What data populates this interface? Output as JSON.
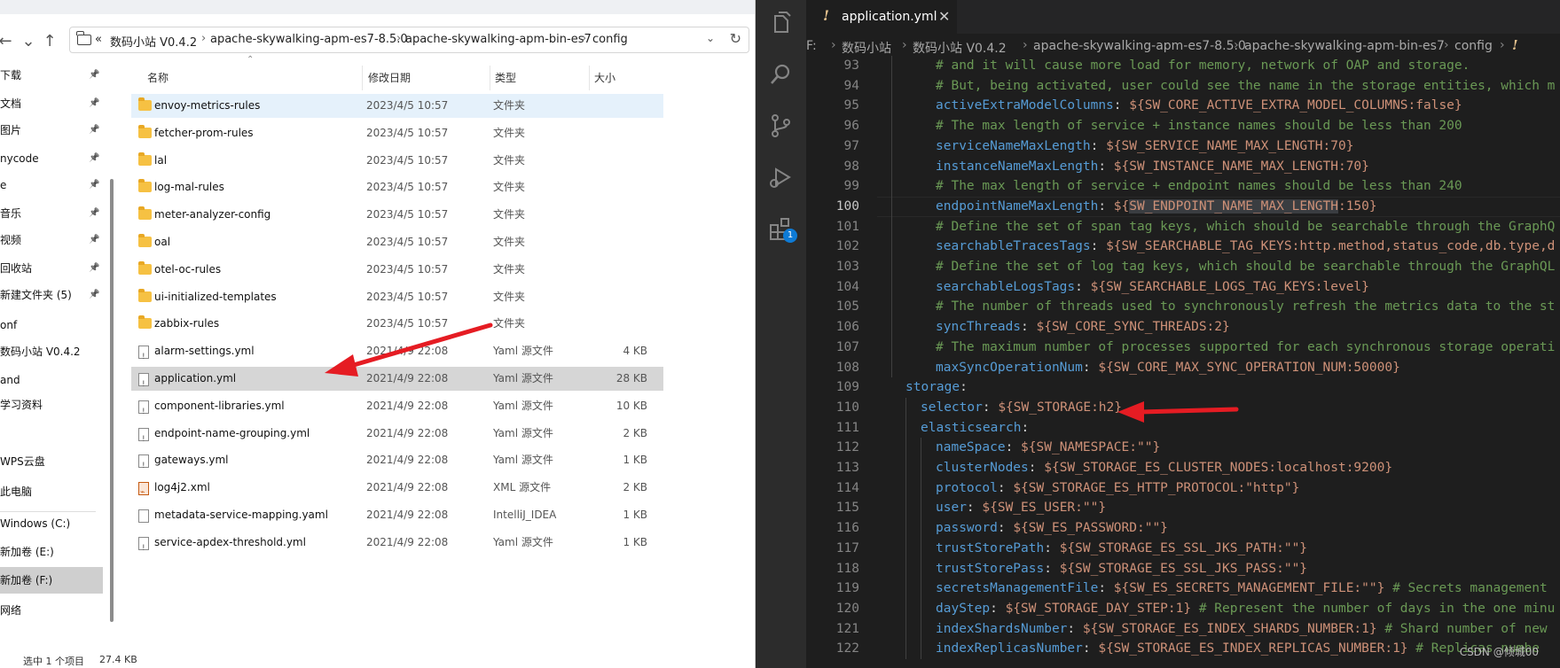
{
  "explorer": {
    "address": {
      "crumbs": [
        "«",
        "数码小站 V0.4.2",
        "apache-skywalking-apm-es7-8.5.0",
        "apache-skywalking-apm-bin-es7",
        "config"
      ]
    },
    "nav_items": [
      {
        "label": "下载",
        "pinned": true
      },
      {
        "label": "文档",
        "pinned": true
      },
      {
        "label": "图片",
        "pinned": true
      },
      {
        "label": "nycode",
        "pinned": true
      },
      {
        "label": "e",
        "pinned": true
      },
      {
        "label": "音乐",
        "pinned": true
      },
      {
        "label": "视频",
        "pinned": true
      },
      {
        "label": "回收站",
        "pinned": true
      },
      {
        "label": "新建文件夹 (5)",
        "pinned": true
      },
      {
        "label": "onf",
        "pinned": false
      },
      {
        "label": "数码小站 V0.4.2",
        "pinned": false
      },
      {
        "label": "and",
        "pinned": false
      },
      {
        "label": "学习资料",
        "pinned": false
      },
      {
        "label": "WPS云盘",
        "pinned": false
      },
      {
        "label": "此电脑",
        "pinned": false
      },
      {
        "label": "Windows (C:)",
        "pinned": false
      },
      {
        "label": "新加卷 (E:)",
        "pinned": false
      },
      {
        "label": "新加卷 (F:)",
        "pinned": false
      },
      {
        "label": "网络",
        "pinned": false
      }
    ],
    "columns": {
      "name": "名称",
      "date": "修改日期",
      "type": "类型",
      "size": "大小"
    },
    "files": [
      {
        "name": "envoy-metrics-rules",
        "date": "2023/4/5 10:57",
        "type": "文件夹",
        "size": "",
        "icon": "folder"
      },
      {
        "name": "fetcher-prom-rules",
        "date": "2023/4/5 10:57",
        "type": "文件夹",
        "size": "",
        "icon": "folder"
      },
      {
        "name": "lal",
        "date": "2023/4/5 10:57",
        "type": "文件夹",
        "size": "",
        "icon": "folder"
      },
      {
        "name": "log-mal-rules",
        "date": "2023/4/5 10:57",
        "type": "文件夹",
        "size": "",
        "icon": "folder"
      },
      {
        "name": "meter-analyzer-config",
        "date": "2023/4/5 10:57",
        "type": "文件夹",
        "size": "",
        "icon": "folder"
      },
      {
        "name": "oal",
        "date": "2023/4/5 10:57",
        "type": "文件夹",
        "size": "",
        "icon": "folder"
      },
      {
        "name": "otel-oc-rules",
        "date": "2023/4/5 10:57",
        "type": "文件夹",
        "size": "",
        "icon": "folder"
      },
      {
        "name": "ui-initialized-templates",
        "date": "2023/4/5 10:57",
        "type": "文件夹",
        "size": "",
        "icon": "folder"
      },
      {
        "name": "zabbix-rules",
        "date": "2023/4/5 10:57",
        "type": "文件夹",
        "size": "",
        "icon": "folder"
      },
      {
        "name": "alarm-settings.yml",
        "date": "2021/4/9 22:08",
        "type": "Yaml 源文件",
        "size": "4 KB",
        "icon": "yaml"
      },
      {
        "name": "application.yml",
        "date": "2021/4/9 22:08",
        "type": "Yaml 源文件",
        "size": "28 KB",
        "icon": "yaml"
      },
      {
        "name": "component-libraries.yml",
        "date": "2021/4/9 22:08",
        "type": "Yaml 源文件",
        "size": "10 KB",
        "icon": "yaml"
      },
      {
        "name": "endpoint-name-grouping.yml",
        "date": "2021/4/9 22:08",
        "type": "Yaml 源文件",
        "size": "2 KB",
        "icon": "yaml"
      },
      {
        "name": "gateways.yml",
        "date": "2021/4/9 22:08",
        "type": "Yaml 源文件",
        "size": "1 KB",
        "icon": "yaml"
      },
      {
        "name": "log4j2.xml",
        "date": "2021/4/9 22:08",
        "type": "XML 源文件",
        "size": "2 KB",
        "icon": "xml"
      },
      {
        "name": "metadata-service-mapping.yaml",
        "date": "2021/4/9 22:08",
        "type": "IntelliJ_IDEA",
        "size": "1 KB",
        "icon": "plain"
      },
      {
        "name": "service-apdex-threshold.yml",
        "date": "2021/4/9 22:08",
        "type": "Yaml 源文件",
        "size": "1 KB",
        "icon": "yaml"
      }
    ],
    "status": {
      "selection": "选中 1 个项目",
      "size": "27.4 KB"
    }
  },
  "vscode": {
    "tab": {
      "name": "application.yml"
    },
    "breadcrumbs": [
      "F:",
      "数码小站",
      "数码小站 V0.4.2",
      "apache-skywalking-apm-es7-8.5.0",
      "apache-skywalking-apm-bin-es7",
      "config"
    ],
    "extensions_badge": "1",
    "active_line": "100",
    "lines": [
      {
        "n": "93",
        "parts": [
          {
            "t": "# and it will cause more load for memory, network of OAP and storage.",
            "c": "c"
          }
        ]
      },
      {
        "n": "94",
        "parts": [
          {
            "t": "# But, being activated, user could see the name in the storage entities, which m",
            "c": "c"
          }
        ]
      },
      {
        "n": "95",
        "parts": [
          {
            "t": "activeExtraModelColumns",
            "c": "k"
          },
          {
            "t": ": ",
            "c": "p"
          },
          {
            "t": "${SW_CORE_ACTIVE_EXTRA_MODEL_COLUMNS:false}",
            "c": "v"
          }
        ]
      },
      {
        "n": "96",
        "parts": [
          {
            "t": "# The max length of service + instance names should be less than 200",
            "c": "c"
          }
        ]
      },
      {
        "n": "97",
        "parts": [
          {
            "t": "serviceNameMaxLength",
            "c": "k"
          },
          {
            "t": ": ",
            "c": "p"
          },
          {
            "t": "${SW_SERVICE_NAME_MAX_LENGTH:70}",
            "c": "v"
          }
        ]
      },
      {
        "n": "98",
        "parts": [
          {
            "t": "instanceNameMaxLength",
            "c": "k"
          },
          {
            "t": ": ",
            "c": "p"
          },
          {
            "t": "${SW_INSTANCE_NAME_MAX_LENGTH:70}",
            "c": "v"
          }
        ]
      },
      {
        "n": "99",
        "parts": [
          {
            "t": "# The max length of service + endpoint names should be less than 240",
            "c": "c"
          }
        ]
      },
      {
        "n": "100",
        "parts": [
          {
            "t": "endpointNameMaxLength",
            "c": "k"
          },
          {
            "t": ": ",
            "c": "p"
          },
          {
            "t": "${",
            "c": "v"
          },
          {
            "t": "SW_ENDPOINT_NAME_MAX_LENGTH",
            "c": "v hl"
          },
          {
            "t": ":150}",
            "c": "v"
          }
        ]
      },
      {
        "n": "101",
        "parts": [
          {
            "t": "# Define the set of span tag keys, which should be searchable through the GraphQ",
            "c": "c"
          }
        ]
      },
      {
        "n": "102",
        "parts": [
          {
            "t": "searchableTracesTags",
            "c": "k"
          },
          {
            "t": ": ",
            "c": "p"
          },
          {
            "t": "${SW_SEARCHABLE_TAG_KEYS:http.method,status_code,db.type,d",
            "c": "v"
          }
        ]
      },
      {
        "n": "103",
        "parts": [
          {
            "t": "# Define the set of log tag keys, which should be searchable through the GraphQL",
            "c": "c"
          }
        ]
      },
      {
        "n": "104",
        "parts": [
          {
            "t": "searchableLogsTags",
            "c": "k"
          },
          {
            "t": ": ",
            "c": "p"
          },
          {
            "t": "${SW_SEARCHABLE_LOGS_TAG_KEYS:level}",
            "c": "v"
          }
        ]
      },
      {
        "n": "105",
        "parts": [
          {
            "t": "# The number of threads used to synchronously refresh the metrics data to the st",
            "c": "c"
          }
        ]
      },
      {
        "n": "106",
        "parts": [
          {
            "t": "syncThreads",
            "c": "k"
          },
          {
            "t": ": ",
            "c": "p"
          },
          {
            "t": "${SW_CORE_SYNC_THREADS:2}",
            "c": "v"
          }
        ]
      },
      {
        "n": "107",
        "parts": [
          {
            "t": "# The maximum number of processes supported for each synchronous storage operati",
            "c": "c"
          }
        ]
      },
      {
        "n": "108",
        "parts": [
          {
            "t": "maxSyncOperationNum",
            "c": "k"
          },
          {
            "t": ": ",
            "c": "p"
          },
          {
            "t": "${SW_CORE_MAX_SYNC_OPERATION_NUM:50000}",
            "c": "v"
          }
        ]
      },
      {
        "n": "109",
        "parts": [
          {
            "t": "storage",
            "c": "k"
          },
          {
            "t": ":",
            "c": "p"
          }
        ]
      },
      {
        "n": "110",
        "parts": [
          {
            "t": "selector",
            "c": "k"
          },
          {
            "t": ": ",
            "c": "p"
          },
          {
            "t": "${SW_STORAGE:h2}",
            "c": "v"
          }
        ]
      },
      {
        "n": "111",
        "parts": [
          {
            "t": "elasticsearch",
            "c": "k"
          },
          {
            "t": ":",
            "c": "p"
          }
        ]
      },
      {
        "n": "112",
        "parts": [
          {
            "t": "nameSpace",
            "c": "k"
          },
          {
            "t": ": ",
            "c": "p"
          },
          {
            "t": "${SW_NAMESPACE:\"\"}",
            "c": "v"
          }
        ]
      },
      {
        "n": "113",
        "parts": [
          {
            "t": "clusterNodes",
            "c": "k"
          },
          {
            "t": ": ",
            "c": "p"
          },
          {
            "t": "${SW_STORAGE_ES_CLUSTER_NODES:localhost:9200}",
            "c": "v"
          }
        ]
      },
      {
        "n": "114",
        "parts": [
          {
            "t": "protocol",
            "c": "k"
          },
          {
            "t": ": ",
            "c": "p"
          },
          {
            "t": "${SW_STORAGE_ES_HTTP_PROTOCOL:\"http\"}",
            "c": "v"
          }
        ]
      },
      {
        "n": "115",
        "parts": [
          {
            "t": "user",
            "c": "k"
          },
          {
            "t": ": ",
            "c": "p"
          },
          {
            "t": "${SW_ES_USER:\"\"}",
            "c": "v"
          }
        ]
      },
      {
        "n": "116",
        "parts": [
          {
            "t": "password",
            "c": "k"
          },
          {
            "t": ": ",
            "c": "p"
          },
          {
            "t": "${SW_ES_PASSWORD:\"\"}",
            "c": "v"
          }
        ]
      },
      {
        "n": "117",
        "parts": [
          {
            "t": "trustStorePath",
            "c": "k"
          },
          {
            "t": ": ",
            "c": "p"
          },
          {
            "t": "${SW_STORAGE_ES_SSL_JKS_PATH:\"\"}",
            "c": "v"
          }
        ]
      },
      {
        "n": "118",
        "parts": [
          {
            "t": "trustStorePass",
            "c": "k"
          },
          {
            "t": ": ",
            "c": "p"
          },
          {
            "t": "${SW_STORAGE_ES_SSL_JKS_PASS:\"\"}",
            "c": "v"
          }
        ]
      },
      {
        "n": "119",
        "parts": [
          {
            "t": "secretsManagementFile",
            "c": "k"
          },
          {
            "t": ": ",
            "c": "p"
          },
          {
            "t": "${SW_ES_SECRETS_MANAGEMENT_FILE:\"\"}",
            "c": "v"
          },
          {
            "t": " # Secrets management",
            "c": "c"
          }
        ]
      },
      {
        "n": "120",
        "parts": [
          {
            "t": "dayStep",
            "c": "k"
          },
          {
            "t": ": ",
            "c": "p"
          },
          {
            "t": "${SW_STORAGE_DAY_STEP:1}",
            "c": "v"
          },
          {
            "t": " # Represent the number of days in the one minu",
            "c": "c"
          }
        ]
      },
      {
        "n": "121",
        "parts": [
          {
            "t": "indexShardsNumber",
            "c": "k"
          },
          {
            "t": ": ",
            "c": "p"
          },
          {
            "t": "${SW_STORAGE_ES_INDEX_SHARDS_NUMBER:1}",
            "c": "v"
          },
          {
            "t": " # Shard number of new",
            "c": "c"
          }
        ]
      },
      {
        "n": "122",
        "parts": [
          {
            "t": "indexReplicasNumber",
            "c": "k"
          },
          {
            "t": ": ",
            "c": "p"
          },
          {
            "t": "${SW_STORAGE_ES_INDEX_REPLICAS_NUMBER:1}",
            "c": "v"
          },
          {
            "t": " # Replicas numbe",
            "c": "c"
          }
        ]
      }
    ],
    "watermark": "CSDN @倾城00"
  }
}
